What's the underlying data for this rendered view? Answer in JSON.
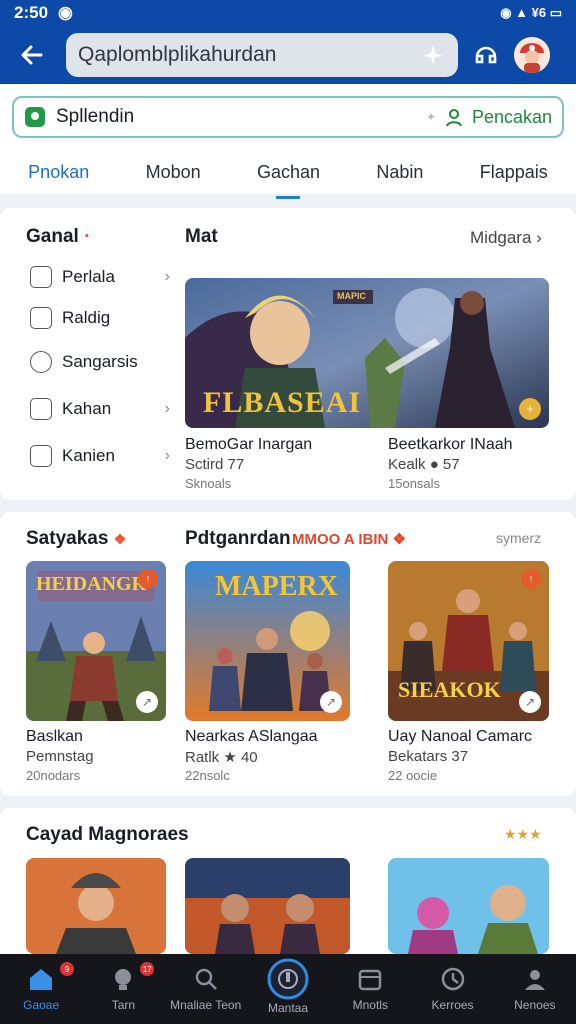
{
  "status": {
    "time": "2:50",
    "right": "◉ ▲ ¥6 ▭"
  },
  "search": {
    "text": "Qaplomblplikahurdan"
  },
  "lang_bar": {
    "left": "Spllendin",
    "right": "Pencakan"
  },
  "tabs": [
    "Pnokan",
    "Mobon",
    "Gachan",
    "Nabin",
    "Flappais"
  ],
  "section1": {
    "left_title": "Ganal",
    "items": [
      "Perlala",
      "Raldig",
      "Sangarsis",
      "Kahan",
      "Kanien"
    ],
    "mid_title": "Mat",
    "link": "Midgara",
    "banner_text": "FLBASEAI",
    "banner_tag": "MAPIC",
    "cards": [
      {
        "title": "BemoGar Inargan",
        "sub": "Sctird 77",
        "meta": "Sknoals"
      },
      {
        "title": "Beetkarkor INaah",
        "sub": "Kealk ● 57",
        "meta": "15onsals"
      }
    ]
  },
  "section2": {
    "title_left": "Satyakas",
    "title_mid": "Pdtganrdan",
    "title_red": "MMOO A IBIN",
    "link": "symerz",
    "cards": [
      {
        "art": "HEIDANGR",
        "title": "Baslkan",
        "sub": "Pemnstag",
        "meta": "20nodars"
      },
      {
        "art": "MAPERX",
        "title": "Nearkas ASlangaa",
        "sub": "Ratlk ★ 40",
        "meta": "22nsolc"
      },
      {
        "art": "SIEAKOK",
        "title": "Uay Nanoal Camarc",
        "sub": "Bekatars 37",
        "meta": "22 oocie"
      }
    ]
  },
  "section3": {
    "title": "Cayad Magnoraes",
    "stars": "★★★"
  },
  "nav": [
    {
      "label": "Gaoae",
      "badge": "9"
    },
    {
      "label": "Tarn",
      "badge": "17"
    },
    {
      "label": "Mnaliae Teon",
      "badge": ""
    },
    {
      "label": "Mantaa",
      "badge": ""
    },
    {
      "label": "Mnotls",
      "badge": ""
    },
    {
      "label": "Kerroes",
      "badge": ""
    },
    {
      "label": "Nenoes",
      "badge": ""
    }
  ],
  "colors": {
    "primary": "#0d4aa8",
    "accent": "#1b7fd6",
    "green": "#1c8a3a",
    "nav_bg": "#14161c"
  }
}
